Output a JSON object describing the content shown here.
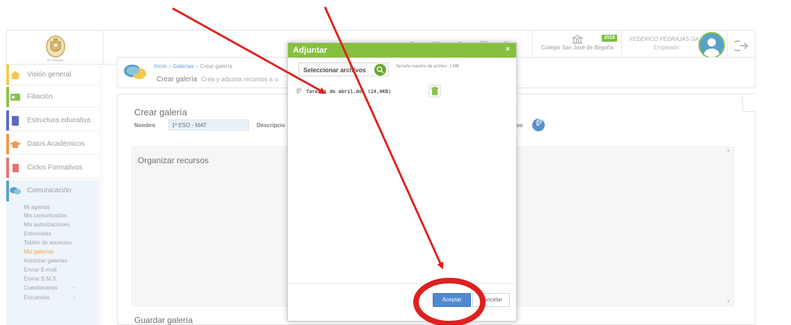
{
  "logo": {
    "caption": "PP Colinistas"
  },
  "topbar": {
    "school_name": "Colegio San José de Begoña",
    "year_badge": "2019",
    "user_name": "FEDERICO PEDRAJAS GA...",
    "user_role": "Empleado",
    "icons": [
      "search-icon",
      "calendar-icon",
      "help-icon",
      "document-icon",
      "history-icon",
      "logout-icon"
    ]
  },
  "sidebar": {
    "items": [
      {
        "label": "Visión general",
        "color": "#f2c94c"
      },
      {
        "label": "Filiación",
        "color": "#8bc34a"
      },
      {
        "label": "Estructura educativa",
        "color": "#5c6bc0"
      },
      {
        "label": "Datos Académicos",
        "color": "#f2994a"
      },
      {
        "label": "Ciclos Formativos",
        "color": "#e57373"
      },
      {
        "label": "Comunicación",
        "color": "#5aa1c9"
      }
    ],
    "sub_items": [
      "Mi agenda",
      "Mis comunicados",
      "Mis autorizaciones",
      "Entrevistas",
      "Tablón de anuncios",
      "Mis galerías",
      "Autorizar galerías",
      "Enviar E-mail",
      "Enviar S.M.S.",
      "Cuestionarios",
      "Encuestas"
    ],
    "active_sub": "Mis galerías"
  },
  "breadcrumb": {
    "items": [
      "Inicio",
      "Galerías",
      "Crear galería"
    ],
    "separator": "›",
    "page_title": "Crear galería",
    "page_subtitle": "Crea y adjunta recursos a u"
  },
  "form": {
    "title": "Crear galería",
    "nombre_label": "Nombre",
    "nombre_value": "1º ESO - MAT",
    "descripcion_label": "Descripcio",
    "so_label": "so",
    "organize_title": "Organizar recursos",
    "save_title": "Guardar galería"
  },
  "modal": {
    "title": "Adjuntar",
    "close": "×",
    "select_files": "Seleccionar archivos",
    "max_size": "Tamaño máximo de archivo: 2 MB",
    "file_name": "Tarea 1 de abril.doc (24,0KB)",
    "accept": "Aceptar",
    "cancel": "Cancelar"
  },
  "colors": {
    "modal_header": "#86c040",
    "accept_button": "#4f8ad0",
    "annotation": "#e0201e",
    "active_menu": "#f0a54a"
  }
}
